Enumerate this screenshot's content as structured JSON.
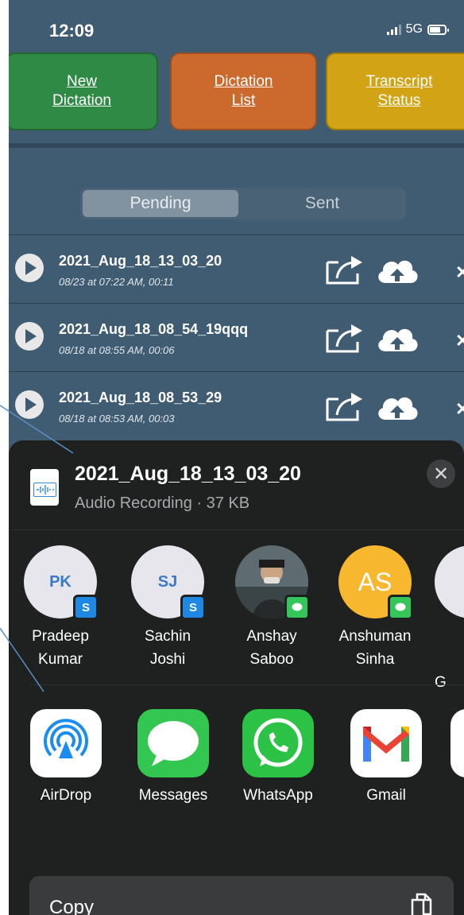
{
  "status_bar": {
    "time": "12:09",
    "network": "5G"
  },
  "nav_buttons": [
    {
      "label": "New\nDictation",
      "color": "#2f8a45"
    },
    {
      "label": "Dictation\nList",
      "color": "#cc6a2e"
    },
    {
      "label": "Transcript\nStatus",
      "color": "#d2a315"
    }
  ],
  "tabs": {
    "active": "Pending",
    "other": "Sent"
  },
  "recordings": [
    {
      "name": "2021_Aug_18_13_03_20",
      "meta": "08/23 at 07:22 AM, 00:11"
    },
    {
      "name": "2021_Aug_18_08_54_19qqq",
      "meta": "08/18 at 08:55 AM, 00:06"
    },
    {
      "name": "2021_Aug_18_08_53_29",
      "meta": "08/18 at 08:53 AM, 00:03"
    }
  ],
  "share_sheet": {
    "file_name": "2021_Aug_18_13_03_20",
    "file_subtitle": "Audio Recording · 37 KB",
    "close_glyph": "✕",
    "people": [
      {
        "initials": "PK",
        "name": "Pradeep\nKumar",
        "badge": "skype",
        "badge_glyph": "S"
      },
      {
        "initials": "SJ",
        "name": "Sachin\nJoshi",
        "badge": "skype",
        "badge_glyph": "S"
      },
      {
        "initials": "",
        "name": "Anshay\nSaboo",
        "badge": "messages",
        "badge_glyph": "",
        "photo": true
      },
      {
        "initials": "AS",
        "name": "Anshuman\nSinha",
        "badge": "messages",
        "badge_glyph": ""
      },
      {
        "initials": "",
        "name": "G",
        "badge": "",
        "badge_glyph": ""
      }
    ],
    "apps": [
      {
        "label": "AirDrop",
        "icon": "airdrop-icon"
      },
      {
        "label": "Messages",
        "icon": "messages-icon"
      },
      {
        "label": "WhatsApp",
        "icon": "whatsapp-icon"
      },
      {
        "label": "Gmail",
        "icon": "gmail-icon"
      }
    ],
    "copy_label": "Copy"
  }
}
